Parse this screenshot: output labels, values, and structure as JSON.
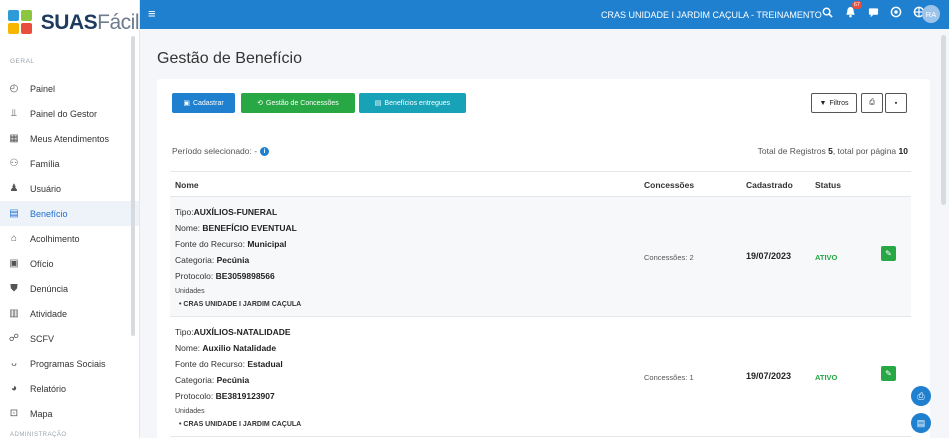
{
  "app": {
    "logo_bold": "SUAS",
    "logo_light": "Fácil"
  },
  "topbar": {
    "unit": "CRAS UNIDADE I JARDIM CAÇULA - TREINAMENTO",
    "notification_count": "67",
    "avatar_initials": "RA"
  },
  "sidebar": {
    "section_geral": "GERAL",
    "section_admin": "ADMINISTRAÇÃO",
    "items": [
      {
        "label": "Painel",
        "icon": "dashboard-icon"
      },
      {
        "label": "Painel do Gestor",
        "icon": "chart-icon"
      },
      {
        "label": "Meus Atendimentos",
        "icon": "briefcase-icon"
      },
      {
        "label": "Família",
        "icon": "family-icon"
      },
      {
        "label": "Usuário",
        "icon": "user-icon"
      },
      {
        "label": "Benefício",
        "icon": "benefit-icon"
      },
      {
        "label": "Acolhimento",
        "icon": "bed-icon"
      },
      {
        "label": "Ofício",
        "icon": "document-icon"
      },
      {
        "label": "Denúncia",
        "icon": "shield-icon"
      },
      {
        "label": "Atividade",
        "icon": "calendar-icon"
      },
      {
        "label": "SCFV",
        "icon": "network-icon"
      },
      {
        "label": "Programas Sociais",
        "icon": "hands-icon"
      },
      {
        "label": "Relatório",
        "icon": "pie-chart-icon"
      },
      {
        "label": "Mapa",
        "icon": "map-icon"
      }
    ]
  },
  "page": {
    "title": "Gestão de Benefício"
  },
  "toolbar": {
    "cadastrar": "Cadastrar",
    "gestao": "Gestão de Concessões",
    "entregues": "Benefícios entregues",
    "filtros": "Filtros"
  },
  "summary": {
    "period_label": "Período selecionado: -",
    "totals_prefix": "Total de Registros",
    "total_registros": "5",
    "totals_mid": ", total por página",
    "per_page": "10"
  },
  "table": {
    "columns": {
      "nome": "Nome",
      "concessoes": "Concessões",
      "cadastrado": "Cadastrado",
      "status": "Status"
    },
    "labels": {
      "tipo": "Tipo:",
      "nome": "Nome:",
      "fonte": "Fonte do Recurso:",
      "categoria": "Categoria:",
      "protocolo": "Protocolo:",
      "unidades": "Unidades"
    },
    "rows": [
      {
        "tipo": "AUXÍLIOS-FUNERAL",
        "nome": "BENEFÍCIO EVENTUAL",
        "fonte": "Municipal",
        "categoria": "Pecúnia",
        "protocolo": "BE3059898566",
        "unidade": "CRAS UNIDADE I JARDIM CAÇULA",
        "concessoes": "Concessões: 2",
        "cadastrado": "19/07/2023",
        "status": "ATIVO"
      },
      {
        "tipo": "AUXÍLIOS-NATALIDADE",
        "nome": "Auxilio Natalidade",
        "fonte": "Estadual",
        "categoria": "Pecúnia",
        "protocolo": "BE3819123907",
        "unidade": "CRAS UNIDADE I JARDIM CAÇULA",
        "concessoes": "Concessões: 1",
        "cadastrado": "19/07/2023",
        "status": "ATIVO"
      }
    ]
  }
}
